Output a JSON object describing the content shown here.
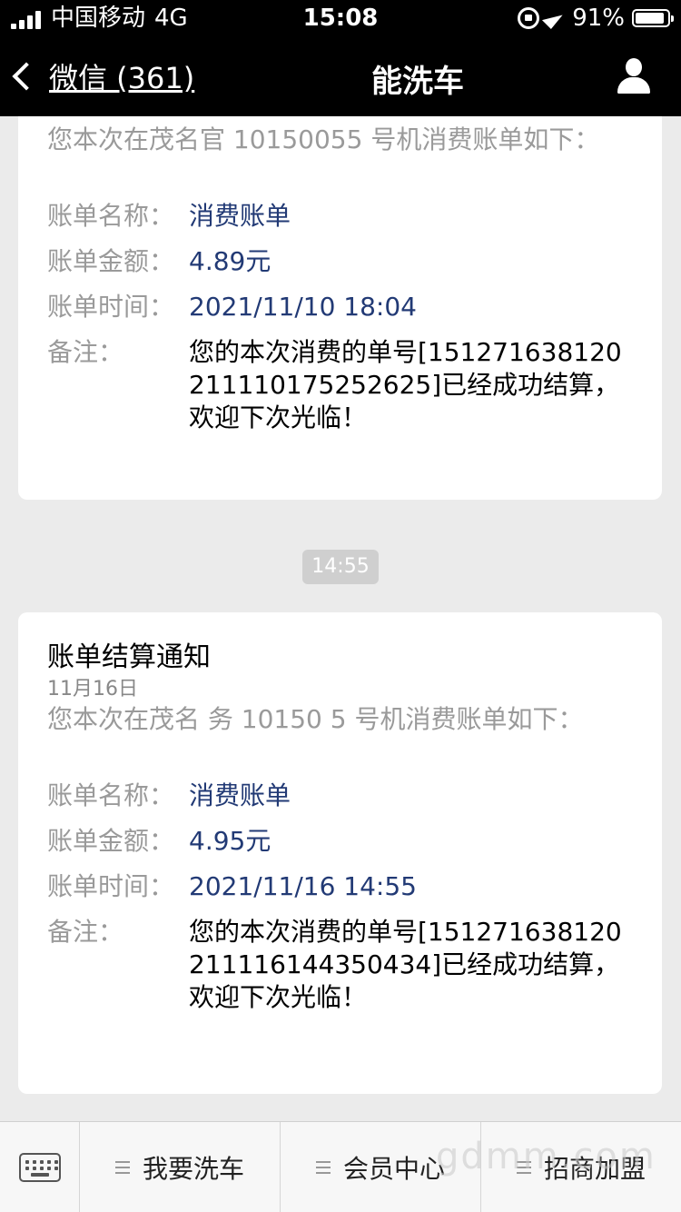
{
  "status_bar": {
    "carrier": "中国移动",
    "network": "4G",
    "time": "15:08",
    "battery": "91%",
    "battery_level": 0.91
  },
  "nav": {
    "back_label": "微信 (361)",
    "title": "能洗车"
  },
  "messages": [
    {
      "intro": "您本次在茂名官 10150055 号机消费账单如下：",
      "fields": [
        {
          "key": "账单名称：",
          "value": "消费账单"
        },
        {
          "key": "账单金额：",
          "value": "4.89元"
        },
        {
          "key": "账单时间：",
          "value": "2021/11/10 18:04"
        },
        {
          "key": "备注：",
          "value": "您的本次消费的单号[151271638120211110175252625]已经成功结算，欢迎下次光临！"
        }
      ]
    },
    {
      "time_badge": "14:55",
      "title": "账单结算通知",
      "date": "11月16日",
      "intro": "您本次在茂名 务 10150 5 号机消费账单如下：",
      "fields": [
        {
          "key": "账单名称：",
          "value": "消费账单"
        },
        {
          "key": "账单金额：",
          "value": "4.95元"
        },
        {
          "key": "账单时间：",
          "value": "2021/11/16 14:55"
        },
        {
          "key": "备注：",
          "value": "您的本次消费的单号[151271638120211116144350434]已经成功结算，欢迎下次光临！"
        }
      ]
    }
  ],
  "bottom_menu": {
    "items": [
      "我要洗车",
      "会员中心",
      "招商加盟"
    ]
  },
  "watermark": "gdmm.com"
}
